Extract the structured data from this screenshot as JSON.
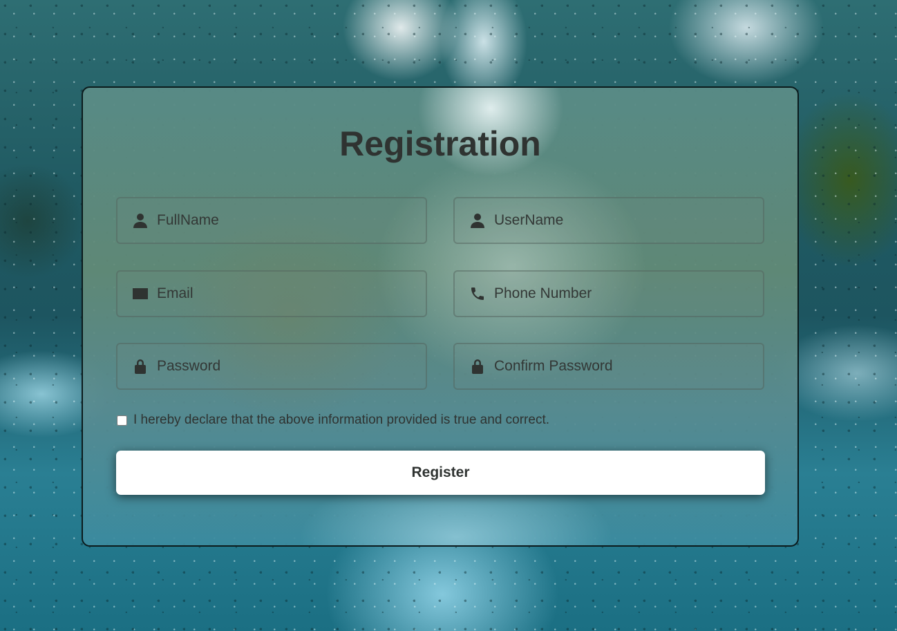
{
  "form": {
    "title": "Registration",
    "fields": [
      {
        "id": "fullname",
        "placeholder": "FullName",
        "icon": "person-icon"
      },
      {
        "id": "username",
        "placeholder": "UserName",
        "icon": "person-icon"
      },
      {
        "id": "email",
        "placeholder": "Email",
        "icon": "envelope-icon"
      },
      {
        "id": "phone",
        "placeholder": "Phone Number",
        "icon": "phone-icon"
      },
      {
        "id": "password",
        "placeholder": "Password",
        "icon": "lock-icon"
      },
      {
        "id": "confirm_password",
        "placeholder": "Confirm Password",
        "icon": "lock-icon"
      }
    ],
    "declaration": "I hereby declare that the above information provided is true and correct.",
    "declaration_checked": false,
    "submit_label": "Register"
  },
  "colors": {
    "text": "#2f3331",
    "button_background": "#ffffff",
    "card_border": "#0b1a1c"
  }
}
